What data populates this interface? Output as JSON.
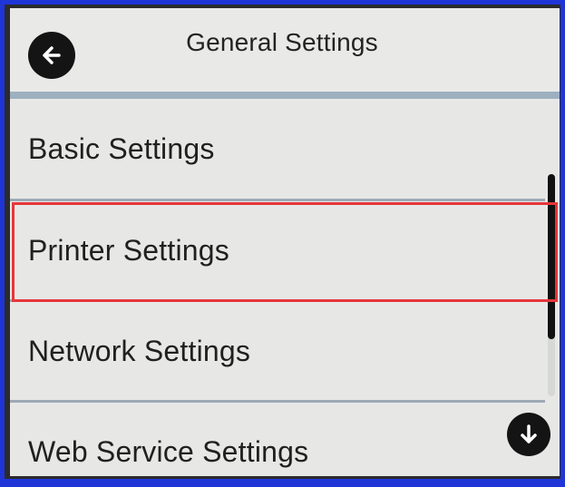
{
  "header": {
    "title": "General Settings",
    "back_icon": "back-arrow-icon"
  },
  "menu": {
    "items": [
      {
        "label": "Basic Settings"
      },
      {
        "label": "Printer Settings",
        "highlighted": true
      },
      {
        "label": "Network Settings"
      },
      {
        "label": "Web Service Settings"
      }
    ]
  },
  "scroll": {
    "down_icon": "down-arrow-icon"
  },
  "colors": {
    "frame": "#1f35d8",
    "highlight": "#e6363b",
    "screen_bg": "#e7e8e6",
    "button_bg": "#141414"
  }
}
